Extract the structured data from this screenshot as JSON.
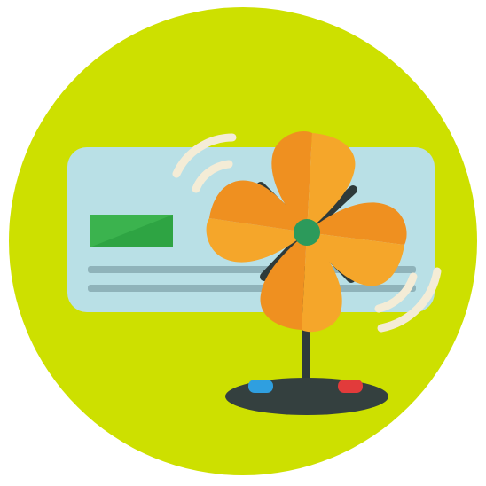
{
  "icon": {
    "name": "air-conditioner-and-fan-icon"
  },
  "colors": {
    "background": "#ffffff",
    "circle": "#cde000",
    "ac_body": "#b9e0e6",
    "ac_stripe": "#8fb3ba",
    "ac_display": "#3bb34e",
    "ac_display_shade": "#2ea443",
    "fan_blade_light": "#f5a62a",
    "fan_blade_dark": "#ef9020",
    "fan_hub": "#2c9a5b",
    "fan_cage": "#2e3a3a",
    "fan_base": "#34403f",
    "button_blue": "#2f9fe0",
    "button_red": "#e23b3b",
    "airflow": "#f4ecd6"
  }
}
